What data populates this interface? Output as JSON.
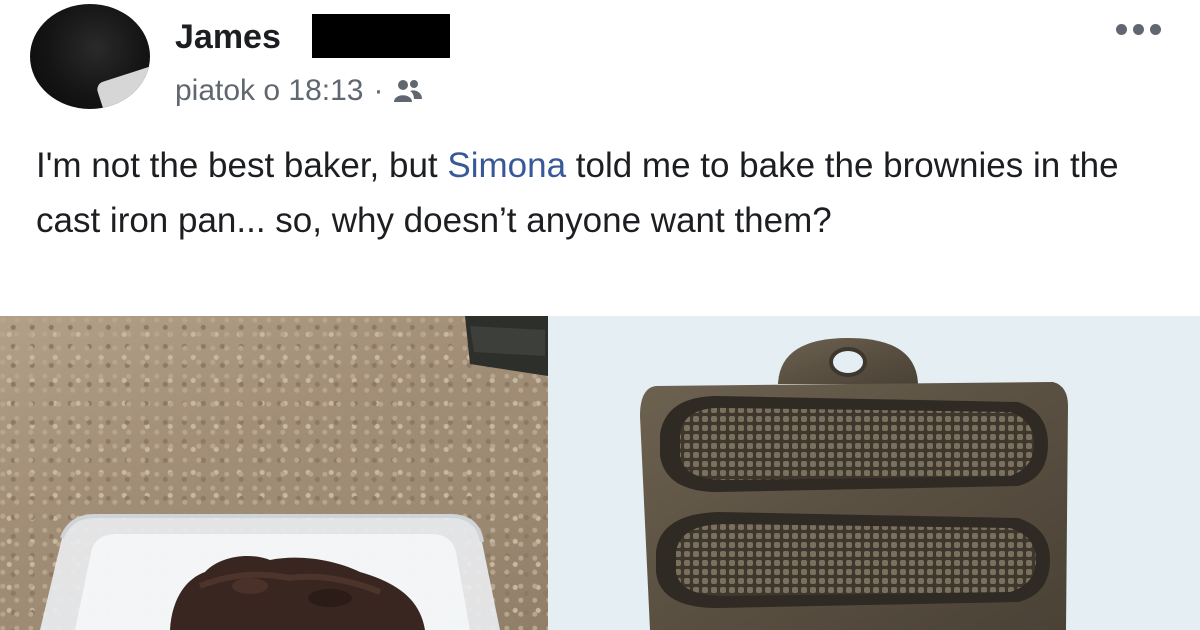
{
  "post": {
    "author_name": "James",
    "timestamp": "piatok o 18:13",
    "separator": "·",
    "audience_icon": "friends-icon",
    "menu_icon": "more-options-icon",
    "text_before_mention": "I'm not the best baker, but ",
    "mention": "Simona",
    "text_after_mention": " told me to bake the brownies in the cast iron pan... so, why doesn’t anyone want them?",
    "mention_color": "#385898"
  }
}
